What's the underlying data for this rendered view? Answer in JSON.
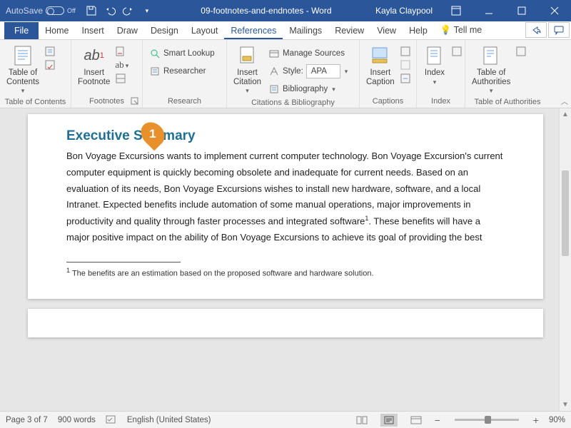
{
  "titlebar": {
    "autosave": "AutoSave",
    "autosave_state": "Off",
    "doc_title": "09-footnotes-and-endnotes - Word",
    "user": "Kayla Claypool"
  },
  "tabs": {
    "file": "File",
    "list": [
      "Home",
      "Insert",
      "Draw",
      "Design",
      "Layout",
      "References",
      "Mailings",
      "Review",
      "View",
      "Help"
    ],
    "tellme": "Tell me",
    "active_index": 5
  },
  "ribbon": {
    "toc": {
      "btn": "Table of\nContents",
      "label": "Table of Contents"
    },
    "footnotes": {
      "btn": "Insert\nFootnote",
      "ab": "ab",
      "label": "Footnotes"
    },
    "research": {
      "smart": "Smart Lookup",
      "researcher": "Researcher",
      "label": "Research"
    },
    "citations": {
      "btn": "Insert\nCitation",
      "manage": "Manage Sources",
      "style_lbl": "Style:",
      "style_val": "APA",
      "biblio": "Bibliography",
      "label": "Citations & Bibliography"
    },
    "captions": {
      "btn": "Insert\nCaption",
      "label": "Captions"
    },
    "index": {
      "btn": "Index",
      "label": "Index"
    },
    "toa": {
      "btn": "Table of\nAuthorities",
      "label": "Table of Authorities"
    }
  },
  "document": {
    "heading": "Executive Summary",
    "body_pre": "Bon Voyage Excursions wants to implement current computer technology. Bon Voyage Excursion's current computer equipment is quickly becoming obsolete and inadequate for current needs. Based on an evaluation of its needs, Bon Voyage Excursions wishes to install new hardware, software, and a local Intranet. Expected benefits include automation of some manual operations, major improvements in productivity and quality through faster processes and integrated software",
    "sup": "1",
    "body_post": ". These benefits will have a major positive impact on the ability of Bon Voyage Excursions to achieve its goal of providing the best",
    "footnote_num": "1",
    "footnote_text": " The benefits are an estimation based on the proposed software and hardware solution."
  },
  "status": {
    "page": "Page 3 of 7",
    "words": "900 words",
    "lang": "English (United States)",
    "zoom": "90%"
  },
  "marker": "1"
}
